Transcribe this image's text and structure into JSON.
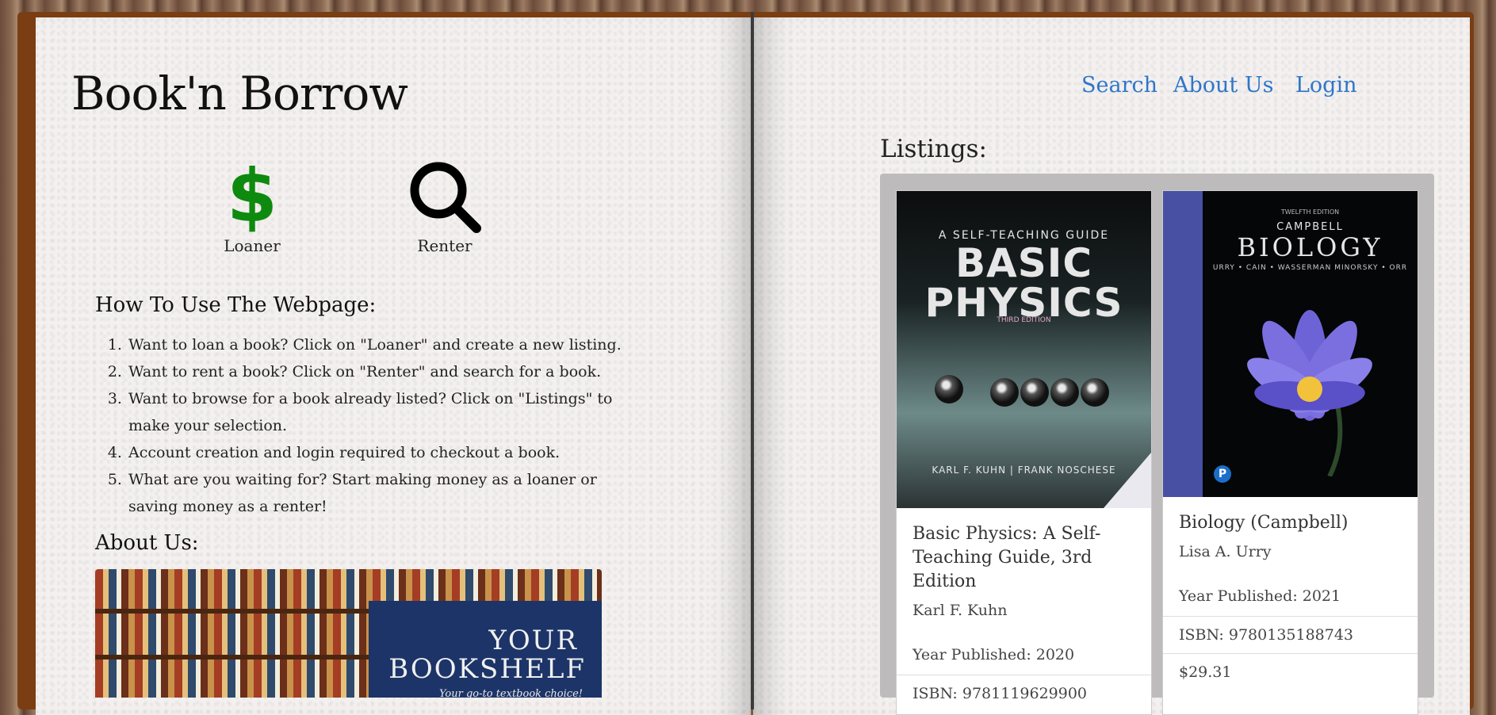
{
  "brand": "Book'n Borrow",
  "nav": {
    "search": "Search",
    "about_us": "About Us",
    "login": "Login"
  },
  "roles": {
    "loaner": {
      "label": "Loaner",
      "icon": "dollar-icon",
      "icon_glyph": "$",
      "color": "#0e8a0e"
    },
    "renter": {
      "label": "Renter",
      "icon": "search-icon",
      "color": "#000000"
    }
  },
  "how_to": {
    "title": "How To Use The Webpage:",
    "steps": [
      "Want to loan a book? Click on \"Loaner\" and create a new listing.",
      "Want to rent a book? Click on \"Renter\" and search for a book.",
      "Want to browse for a book already listed? Click on \"Listings\" to make your selection.",
      "Account creation and login required to checkout a book.",
      "What are you waiting for? Start making money as a loaner or saving money as a renter!"
    ]
  },
  "about": {
    "title": "About Us:",
    "banner": {
      "line1": "YOUR",
      "line2": "BOOKSHELF",
      "tagline": "Your go-to textbook choice!"
    }
  },
  "listings": {
    "title": "Listings:",
    "items": [
      {
        "title": "Basic Physics: A Self-Teaching Guide, 3rd Edition",
        "author": "Karl F. Kuhn",
        "year": "Year Published: 2020",
        "isbn": "ISBN: 9781119629900",
        "price": "",
        "cover": {
          "guide": "A SELF-TEACHING GUIDE",
          "big": "BASIC PHYSICS",
          "edition": "THIRD EDITION",
          "authors": "KARL F. KUHN  |  FRANK NOSCHESE"
        }
      },
      {
        "title": "Biology (Campbell)",
        "author": "Lisa A. Urry",
        "year": "Year Published: 2021",
        "isbn": "ISBN: 9780135188743",
        "price": "$29.31",
        "cover": {
          "edition": "TWELFTH EDITION",
          "campbell": "CAMPBELL",
          "big": "BIOLOGY",
          "authors": "URRY • CAIN • WASSERMAN MINORSKY • ORR",
          "publisher_mark": "P"
        }
      }
    ]
  },
  "colors": {
    "link": "#2f76c9",
    "book_cover": "#7a3e12",
    "listings_bg": "#bdbbbb"
  }
}
